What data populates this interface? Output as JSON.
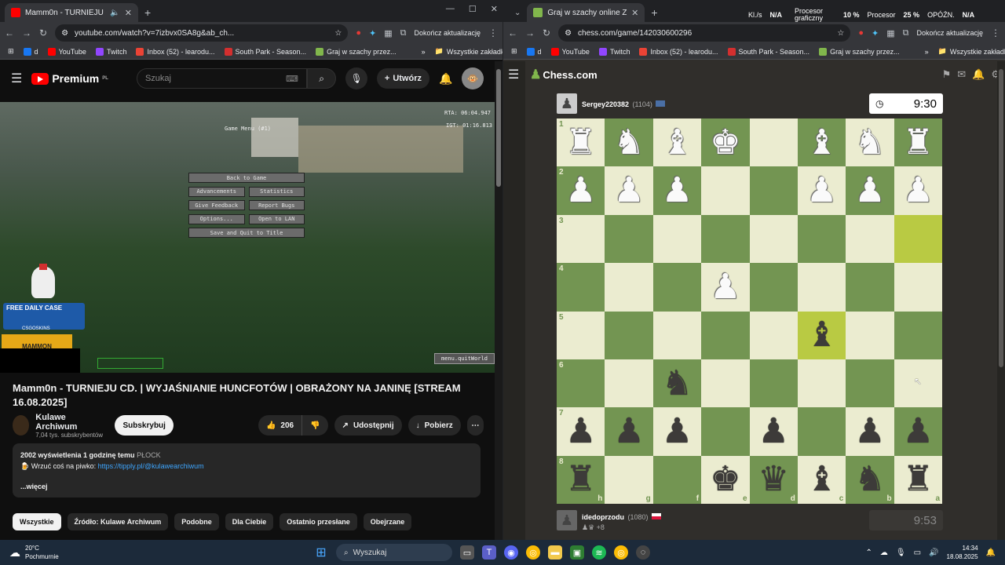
{
  "left": {
    "tab_title": "Mamm0n - TURNIEJU CD. | W",
    "url": "youtube.com/watch?v=7izbvx0SA8g&ab_ch...",
    "update_label": "Dokończ aktualizację",
    "bookmarks": [
      "d",
      "YouTube",
      "Twitch",
      "Inbox (52) - learodu...",
      "South Park - Season...",
      "Graj w szachy przez..."
    ],
    "all_bookmarks": "Wszystkie zakładki",
    "yt": {
      "logo": "Premium",
      "region": "PL",
      "search_placeholder": "Szukaj",
      "create_label": "Utwórz",
      "video_overlay": {
        "game_menu": "Game Menu (#1)",
        "rta": "RTA: 06:04.947",
        "igt": "IGT: 01:16.813",
        "back": "Back to Game",
        "advancements": "Advancements",
        "statistics": "Statistics",
        "feedback": "Give Feedback",
        "bugs": "Report Bugs",
        "options": "Options...",
        "lan": "Open to LAN",
        "save": "Save and Quit to Title",
        "world": "menu.quitWorld",
        "free_case": "FREE DAILY CASE",
        "skins": "CSGOSKINS",
        "mammon": "MAMMON"
      },
      "title": "Mamm0n - TURNIEJU CD. | WYJAŚNIANIE HUNCFOTÓW | OBRAŻONY NA JANINĘ [STREAM 16.08.2025]",
      "channel": "Kulawe Archiwum",
      "subs": "7,04 tys. subskrybentów",
      "subscribe": "Subskrybuj",
      "likes": "206",
      "share": "Udostępnij",
      "download": "Pobierz",
      "views": "2002 wyświetlenia  1 godzinę temu",
      "tag": "PŁOCK",
      "desc_line": "Wrzuć coś na piwko:",
      "desc_link": "https://tipply.pl/@kulawearchiwum",
      "more": "...więcej",
      "chips": [
        "Wszystkie",
        "Źródło: Kulawe Archiwum",
        "Podobne",
        "Dla Ciebie",
        "Ostatnio przesłane",
        "Obejrzane"
      ]
    }
  },
  "right": {
    "tab_title": "Graj w szachy online ZA DARMO",
    "stats": {
      "kls": "Kl./s",
      "kls_val": "N/A",
      "gpu": "Procesor graficzny",
      "gpu_val": "10 %",
      "cpu": "Procesor",
      "cpu_val": "25 %",
      "delay": "OPÓŹN.",
      "delay_val": "N/A"
    },
    "url": "chess.com/game/142030600296",
    "update_label": "Dokończ aktualizację",
    "bookmarks": [
      "d",
      "YouTube",
      "Twitch",
      "Inbox (52) - learodu...",
      "South Park - Season...",
      "Graj w szachy przez..."
    ],
    "all_bookmarks": "Wszystkie zakładki",
    "logo": "Chess.com",
    "top_player": {
      "name": "Sergey220382",
      "rating": "(1104)",
      "clock": "9:30"
    },
    "bottom_player": {
      "name": "idedoprzodu",
      "rating": "(1080)",
      "extra": "+8",
      "clock": "9:53"
    },
    "board": {
      "ranks": [
        "1",
        "2",
        "3",
        "4",
        "5",
        "6",
        "7",
        "8"
      ],
      "files": [
        "h",
        "g",
        "f",
        "e",
        "d",
        "c",
        "b",
        "a"
      ],
      "rows": [
        [
          "wR",
          "wN",
          "wB",
          "wK",
          "",
          "wB",
          "wN",
          "wR"
        ],
        [
          "wP",
          "wP",
          "wP",
          "",
          "",
          "wP",
          "wP",
          "wP"
        ],
        [
          "",
          "",
          "",
          "",
          "",
          "",
          "",
          ""
        ],
        [
          "",
          "",
          "",
          "wP",
          "",
          "",
          "",
          ""
        ],
        [
          "",
          "",
          "",
          "",
          "",
          "bB",
          "",
          ""
        ],
        [
          "",
          "",
          "bN",
          "",
          "",
          "",
          "",
          ""
        ],
        [
          "bP",
          "bP",
          "bP",
          "",
          "bP",
          "",
          "bP",
          "bP"
        ],
        [
          "bR",
          "",
          "",
          "bK",
          "bQ",
          "bB",
          "bN",
          "bR"
        ]
      ],
      "highlights": [
        "4,5",
        "2,7"
      ]
    }
  },
  "taskbar": {
    "temp": "20°C",
    "weather": "Pochmurnie",
    "search": "Wyszukaj",
    "time": "14:34",
    "date": "18.08.2025"
  }
}
